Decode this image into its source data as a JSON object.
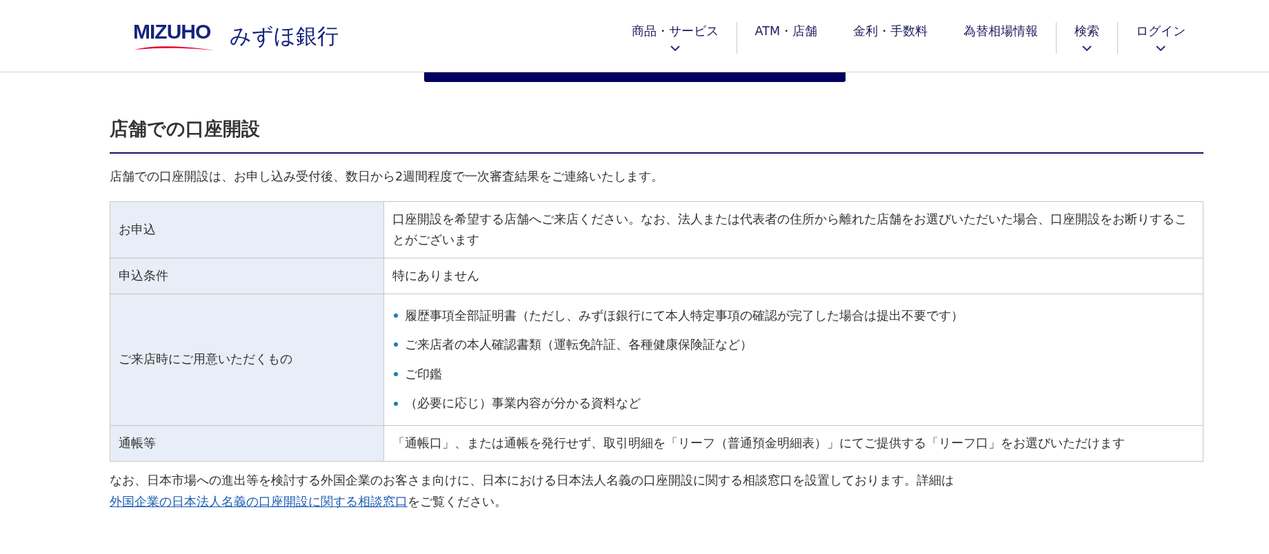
{
  "header": {
    "logo_text": "MIZUHO",
    "bank_name": "みずほ銀行",
    "nav": [
      {
        "label": "商品・サービス",
        "has_menu": true,
        "divider_after": true
      },
      {
        "label": "ATM・店舗",
        "has_menu": false,
        "divider_after": false
      },
      {
        "label": "金利・手数料",
        "has_menu": false,
        "divider_after": false
      },
      {
        "label": "為替相場情報",
        "has_menu": false,
        "divider_after": true
      },
      {
        "label": "検索",
        "has_menu": true,
        "divider_after": true
      },
      {
        "label": "ログイン",
        "has_menu": true,
        "divider_after": false
      }
    ]
  },
  "section": {
    "title": "店舗での口座開設",
    "intro": "店舗での口座開設は、お申し込み受付後、数日から2週間程度で一次審査結果をご連絡いたします。",
    "table": {
      "rows": [
        {
          "label": "お申込",
          "kind": "text",
          "text": "口座開設を希望する店舗へご来店ください。なお、法人または代表者の住所から離れた店舗をお選びいただいた場合、口座開設をお断りすることがございます"
        },
        {
          "label": "申込条件",
          "kind": "text",
          "text": "特にありません"
        },
        {
          "label": "ご来店時にご用意いただくもの",
          "kind": "list",
          "items": [
            "履歴事項全部証明書（ただし、みずほ銀行にて本人特定事項の確認が完了した場合は提出不要です）",
            "ご来店者の本人確認書類（運転免許証、各種健康保険証など）",
            "ご印鑑",
            "（必要に応じ）事業内容が分かる資料など"
          ]
        },
        {
          "label": "通帳等",
          "kind": "text",
          "text": "「通帳口」、または通帳を発行せず、取引明細を「リーフ（普通預金明細表）」にてご提供する「リーフ口」をお選びいただけます"
        }
      ]
    },
    "note": {
      "before": "なお、日本市場への進出等を検討する外国企業のお客さま向けに、日本における日本法人名義の口座開設に関する相談窓口を設置しております。詳細は",
      "link": "外国企業の日本法人名義の口座開設に関する相談窓口",
      "after": "をご覧ください。"
    }
  }
}
